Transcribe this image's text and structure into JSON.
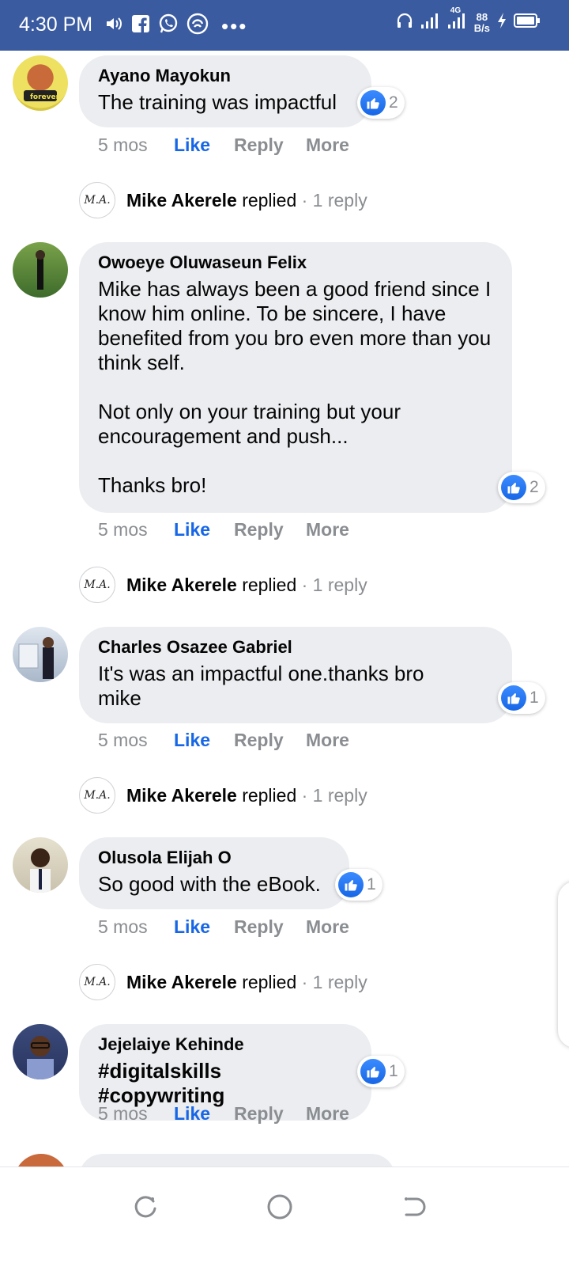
{
  "status_bar": {
    "time": "4:30 PM",
    "network": "4G",
    "speed_value": "88",
    "speed_unit": "B/s",
    "dots": "•••"
  },
  "comments": [
    {
      "author": "Ayano Mayokun",
      "text": "The training was impactful",
      "reaction_count": "2",
      "time": "5 mos",
      "like_label": "Like",
      "reply_label": "Reply",
      "more_label": "More",
      "replied": {
        "name": "Mike Akerele",
        "verb": "replied",
        "count": "· 1 reply"
      }
    },
    {
      "author": "Owoeye Oluwaseun Felix",
      "text": "Mike has always been a good friend since I know him online. To be sincere, I have benefited from you bro even more than you think self.\n\nNot only on your training but your encouragement and push...\n\nThanks bro!",
      "reaction_count": "2",
      "time": "5 mos",
      "like_label": "Like",
      "reply_label": "Reply",
      "more_label": "More",
      "replied": {
        "name": "Mike Akerele",
        "verb": "replied",
        "count": "· 1 reply"
      }
    },
    {
      "author": "Charles Osazee Gabriel",
      "text": "It's was an impactful one.thanks bro mike",
      "reaction_count": "1",
      "time": "5 mos",
      "like_label": "Like",
      "reply_label": "Reply",
      "more_label": "More",
      "replied": {
        "name": "Mike Akerele",
        "verb": "replied",
        "count": "· 1 reply"
      }
    },
    {
      "author": "Olusola Elijah O",
      "text": "So good with the eBook.",
      "reaction_count": "1",
      "time": "5 mos",
      "like_label": "Like",
      "reply_label": "Reply",
      "more_label": "More",
      "replied": {
        "name": "Mike Akerele",
        "verb": "replied",
        "count": "· 1 reply"
      }
    },
    {
      "author": "Jejelaiye Kehinde",
      "text": "#digitalskills #copywriting",
      "reaction_count": "1",
      "time": "5 mos",
      "like_label": "Like",
      "reply_label": "Reply",
      "more_label": "More"
    }
  ],
  "replier_avatar_initials": "M.A.",
  "colors": {
    "status_bar": "#3a5ba0",
    "like_blue": "#1766e6",
    "bubble": "#ebedf0",
    "muted_text": "#8a8d91"
  }
}
